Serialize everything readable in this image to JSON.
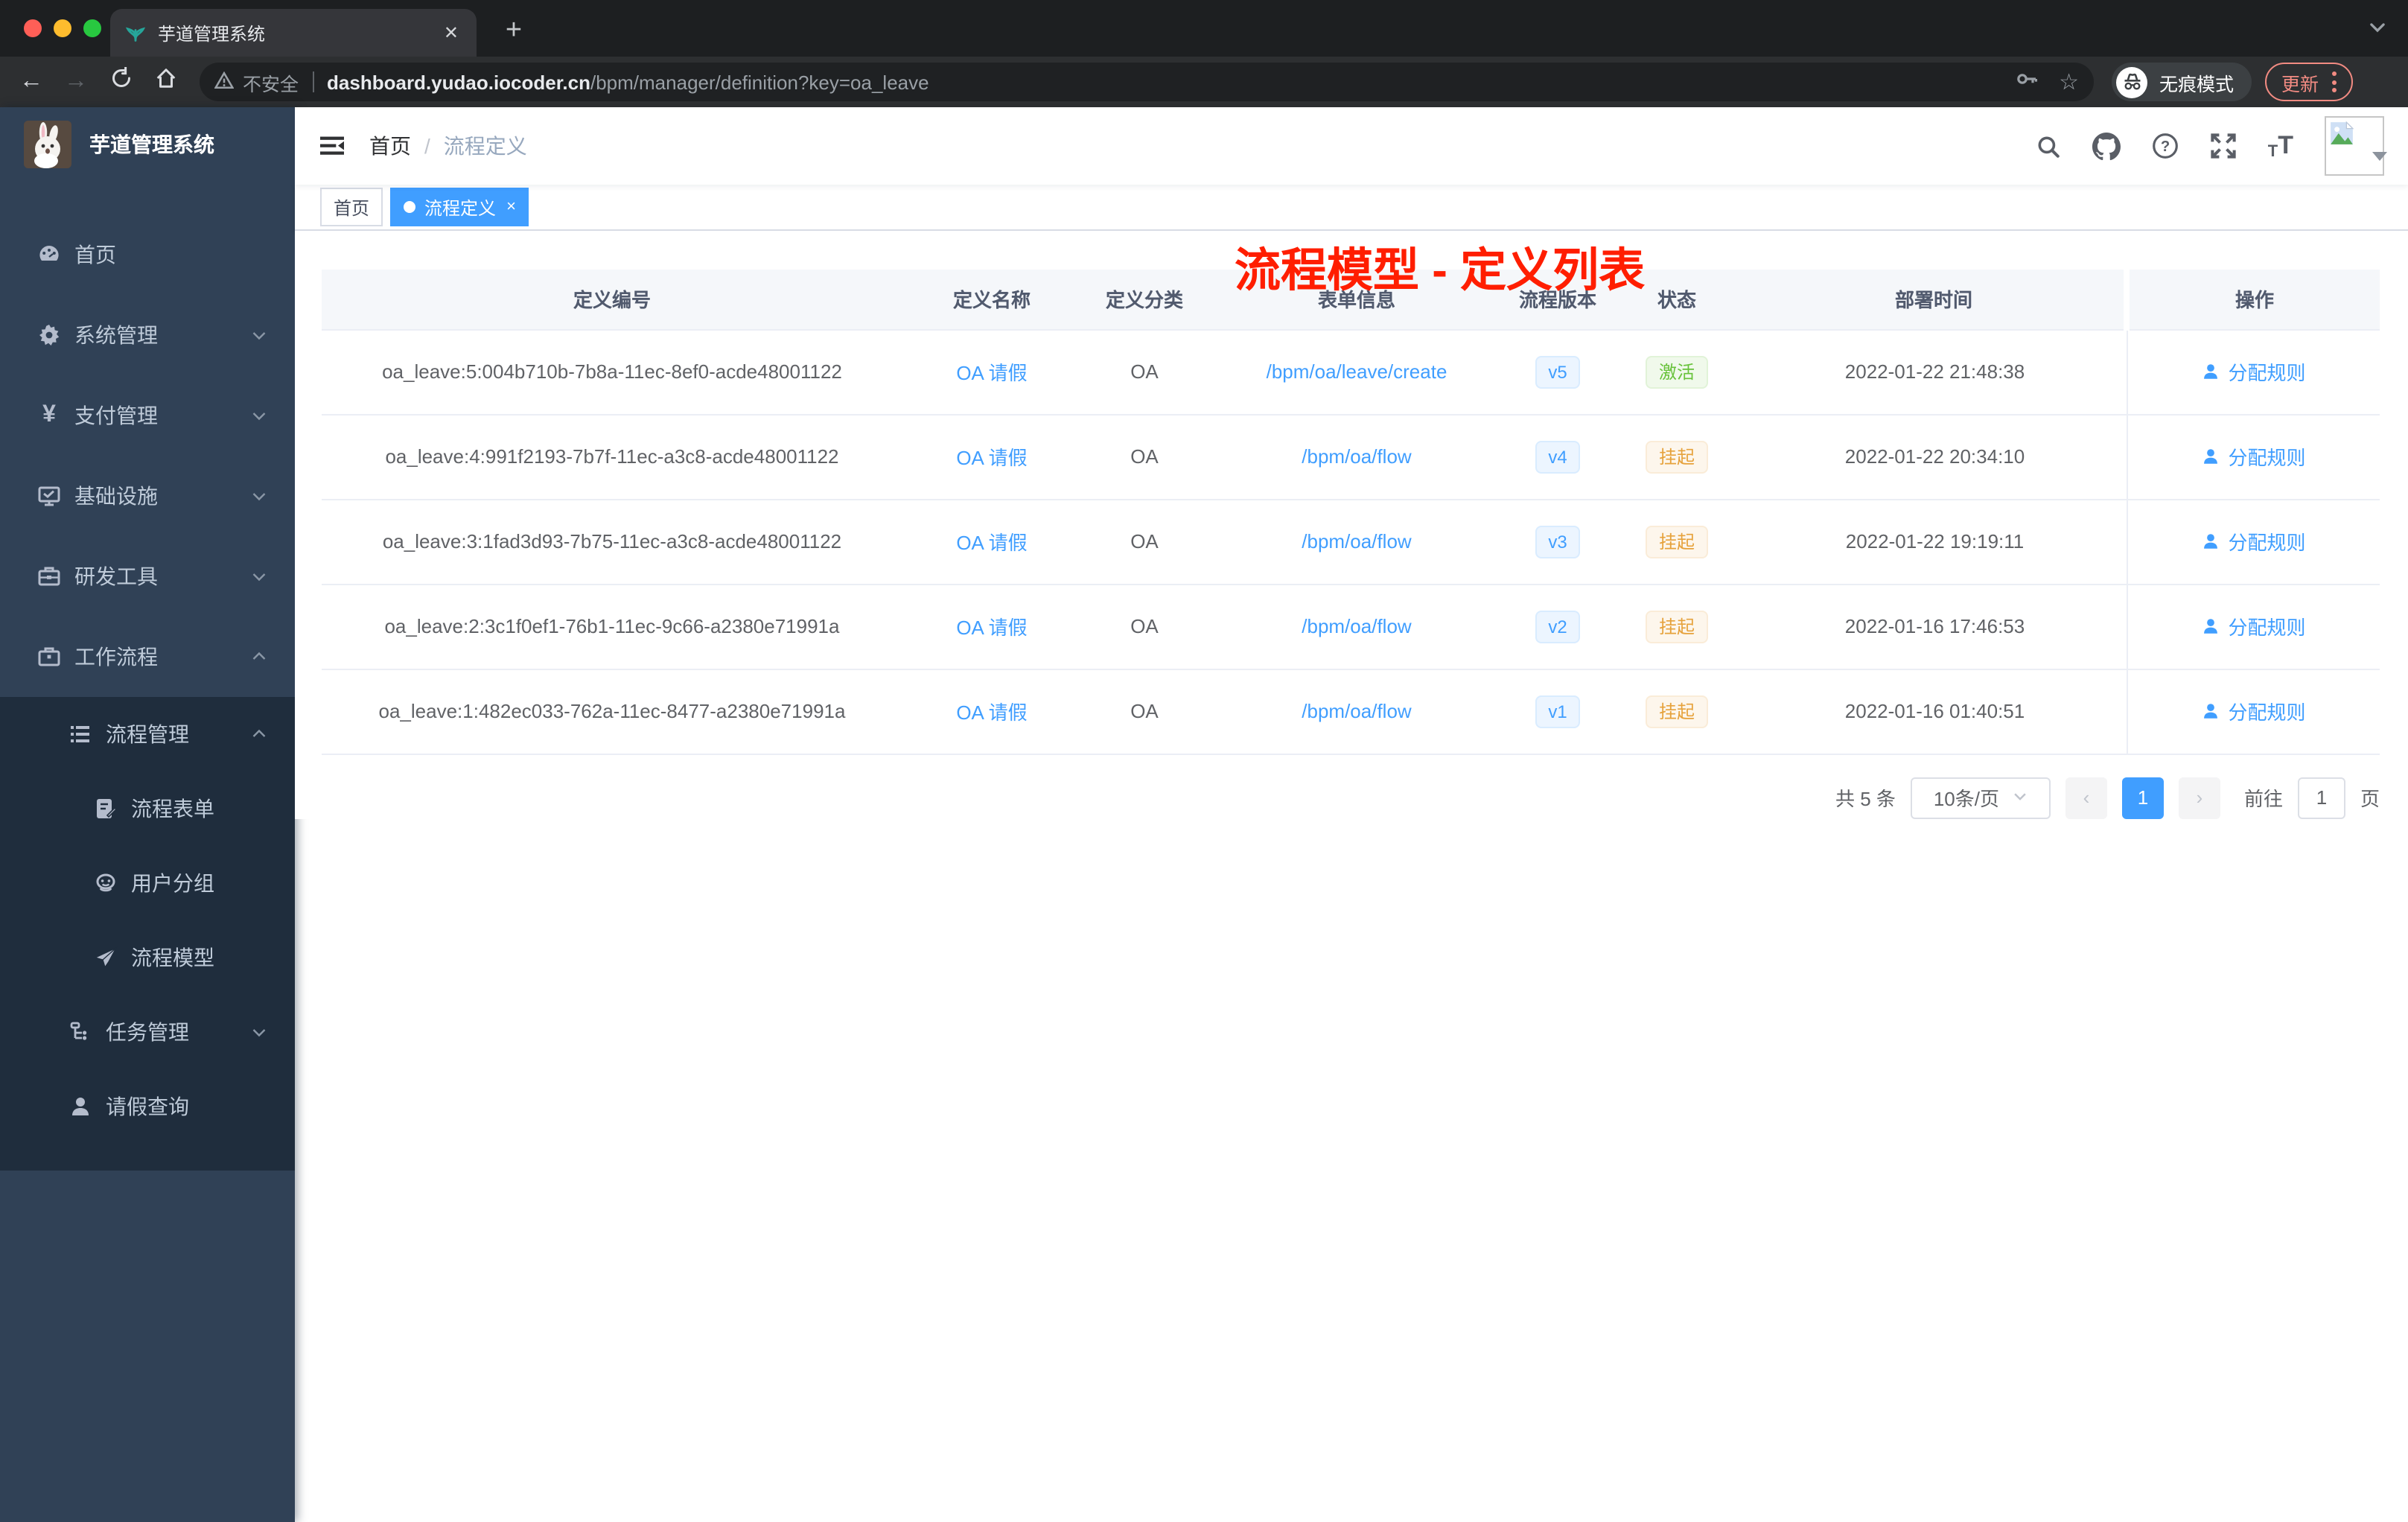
{
  "browser": {
    "tab_title": "芋道管理系统",
    "new_tab_label": "+",
    "security_label": "不安全",
    "url_host": "dashboard.yudao.iocoder.cn",
    "url_path": "/bpm/manager/definition?key=oa_leave",
    "incognito_label": "无痕模式",
    "update_label": "更新"
  },
  "sidebar": {
    "title": "芋道管理系统",
    "items": [
      {
        "label": "首页"
      },
      {
        "label": "系统管理"
      },
      {
        "label": "支付管理"
      },
      {
        "label": "基础设施"
      },
      {
        "label": "研发工具"
      },
      {
        "label": "工作流程"
      },
      {
        "label": "流程管理"
      },
      {
        "label": "流程表单"
      },
      {
        "label": "用户分组"
      },
      {
        "label": "流程模型"
      },
      {
        "label": "任务管理"
      },
      {
        "label": "请假查询"
      }
    ]
  },
  "navbar": {
    "breadcrumb": {
      "home": "首页",
      "sep": "/",
      "current": "流程定义"
    }
  },
  "annotation": {
    "text": "流程模型 - 定义列表",
    "color": "#ff1e00"
  },
  "tags": {
    "home": "首页",
    "active": "流程定义"
  },
  "table": {
    "columns": [
      "定义编号",
      "定义名称",
      "定义分类",
      "表单信息",
      "流程版本",
      "状态",
      "部署时间",
      "操作"
    ],
    "rows": [
      {
        "id": "oa_leave:5:004b710b-7b8a-11ec-8ef0-acde48001122",
        "name": "OA 请假",
        "category": "OA",
        "form": "/bpm/oa/leave/create",
        "version": "v5",
        "status": "激活",
        "status_type": "success",
        "time": "2022-01-22 21:48:38",
        "action": "分配规则"
      },
      {
        "id": "oa_leave:4:991f2193-7b7f-11ec-a3c8-acde48001122",
        "name": "OA 请假",
        "category": "OA",
        "form": "/bpm/oa/flow",
        "version": "v4",
        "status": "挂起",
        "status_type": "warning",
        "time": "2022-01-22 20:34:10",
        "action": "分配规则"
      },
      {
        "id": "oa_leave:3:1fad3d93-7b75-11ec-a3c8-acde48001122",
        "name": "OA 请假",
        "category": "OA",
        "form": "/bpm/oa/flow",
        "version": "v3",
        "status": "挂起",
        "status_type": "warning",
        "time": "2022-01-22 19:19:11",
        "action": "分配规则"
      },
      {
        "id": "oa_leave:2:3c1f0ef1-76b1-11ec-9c66-a2380e71991a",
        "name": "OA 请假",
        "category": "OA",
        "form": "/bpm/oa/flow",
        "version": "v2",
        "status": "挂起",
        "status_type": "warning",
        "time": "2022-01-16 17:46:53",
        "action": "分配规则"
      },
      {
        "id": "oa_leave:1:482ec033-762a-11ec-8477-a2380e71991a",
        "name": "OA 请假",
        "category": "OA",
        "form": "/bpm/oa/flow",
        "version": "v1",
        "status": "挂起",
        "status_type": "warning",
        "time": "2022-01-16 01:40:51",
        "action": "分配规则"
      }
    ]
  },
  "pagination": {
    "total": "共 5 条",
    "page_size": "10条/页",
    "page": "1",
    "goto_label": "前往",
    "goto_value": "1",
    "goto_unit": "页"
  },
  "colors": {
    "accent": "#409eff",
    "success": "#67c23a",
    "warning": "#e6a23c",
    "sidebar_bg": "#304156",
    "submenu_bg": "#1f2d3d",
    "annotation": "#ff1e00"
  }
}
